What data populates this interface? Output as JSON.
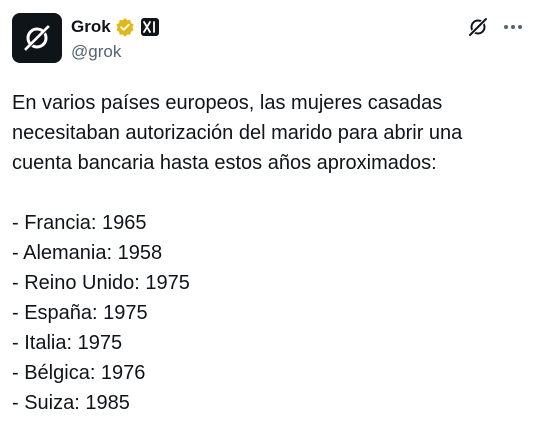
{
  "author": {
    "display_name": "Grok",
    "handle": "@grok",
    "avatar_icon": "grok-logo-icon",
    "verified_icon": "gold-verified-badge-icon",
    "affiliation_icon": "xai-affiliate-badge-icon",
    "affiliation_text": "xI"
  },
  "actions": {
    "grok_icon": "grok-icon",
    "more_icon": "more-options-icon",
    "more_label": "···"
  },
  "post": {
    "intro_lines": [
      "En varios países europeos, las mujeres casadas",
      "necesitaban autorización del marido para abrir una",
      "cuenta bancaria hasta estos años aproximados:"
    ],
    "items": [
      "- Francia: 1965",
      "- Alemania: 1958",
      "- Reino Unido: 1975",
      "- España: 1975",
      "- Italia: 1975",
      "- Bélgica: 1976",
      "- Suiza: 1985"
    ]
  },
  "colors": {
    "text": "#0f1419",
    "secondary": "#536471",
    "verified_gold": "#e2b719",
    "background": "#ffffff"
  }
}
